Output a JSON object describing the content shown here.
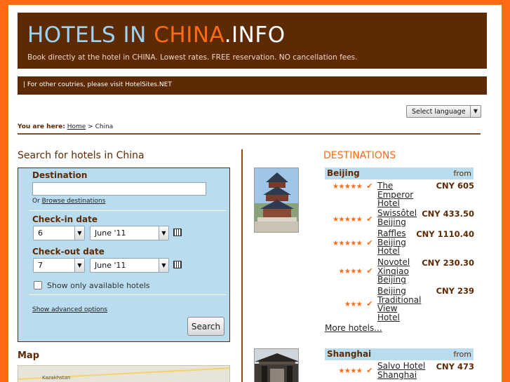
{
  "header": {
    "title_part1": "HOTELS IN ",
    "title_part2": "CHINA",
    "title_part3": ".INFO",
    "tagline": "Book directly at the hotel in CHINA. Lowest rates. FREE reservation. NO cancellation fees.",
    "subbar": "| For other coutries, please visit HotelSites.NET",
    "colors": {
      "brand": "#5c2a05",
      "accent": "#ff6a13",
      "panel": "#b9dcee"
    }
  },
  "language": {
    "label": "Select language",
    "arrow": "▼"
  },
  "breadcrumb": {
    "prefix": "You are here:",
    "home": "Home",
    "separator": ">",
    "current": "China"
  },
  "search": {
    "title": "Search for hotels in China",
    "destination_label": "Destination",
    "destination_value": "",
    "browse_prefix": "Or",
    "browse_link": "Browse destinations",
    "checkin_label": "Check-in date",
    "checkin_day": "6",
    "checkin_month": "June '11",
    "checkout_label": "Check-out date",
    "checkout_day": "7",
    "checkout_month": "June '11",
    "available_only": "Show only available hotels",
    "advanced": "Show advanced options",
    "button": "Search"
  },
  "map": {
    "title": "Map",
    "place": "Kazakhstan"
  },
  "destinations": {
    "title": "DESTINATIONS",
    "cities": [
      {
        "name": "Beijing",
        "from_label": "from",
        "hotels": [
          {
            "stars": "★★★★★",
            "name": "The Emperor Hotel",
            "price": "CNY 605"
          },
          {
            "stars": "★★★★★",
            "name": "Swissôtel Beijing",
            "price": "CNY 433.50"
          },
          {
            "stars": "★★★★★",
            "name": "Raffles Beijing Hotel",
            "price": "CNY 1110.40"
          },
          {
            "stars": "★★★★",
            "name": "Novotel Xinqiao Beijing",
            "price": "CNY 230.30"
          },
          {
            "stars": "★★★",
            "name": "Beijing Traditional View Hotel",
            "price": "CNY 239"
          }
        ],
        "more": "More hotels..."
      },
      {
        "name": "Shanghai",
        "from_label": "from",
        "hotels": [
          {
            "stars": "★★★★",
            "name": "Salvo Hotel Shanghai",
            "price": "CNY 473"
          }
        ]
      }
    ],
    "check_icon": "✔"
  }
}
